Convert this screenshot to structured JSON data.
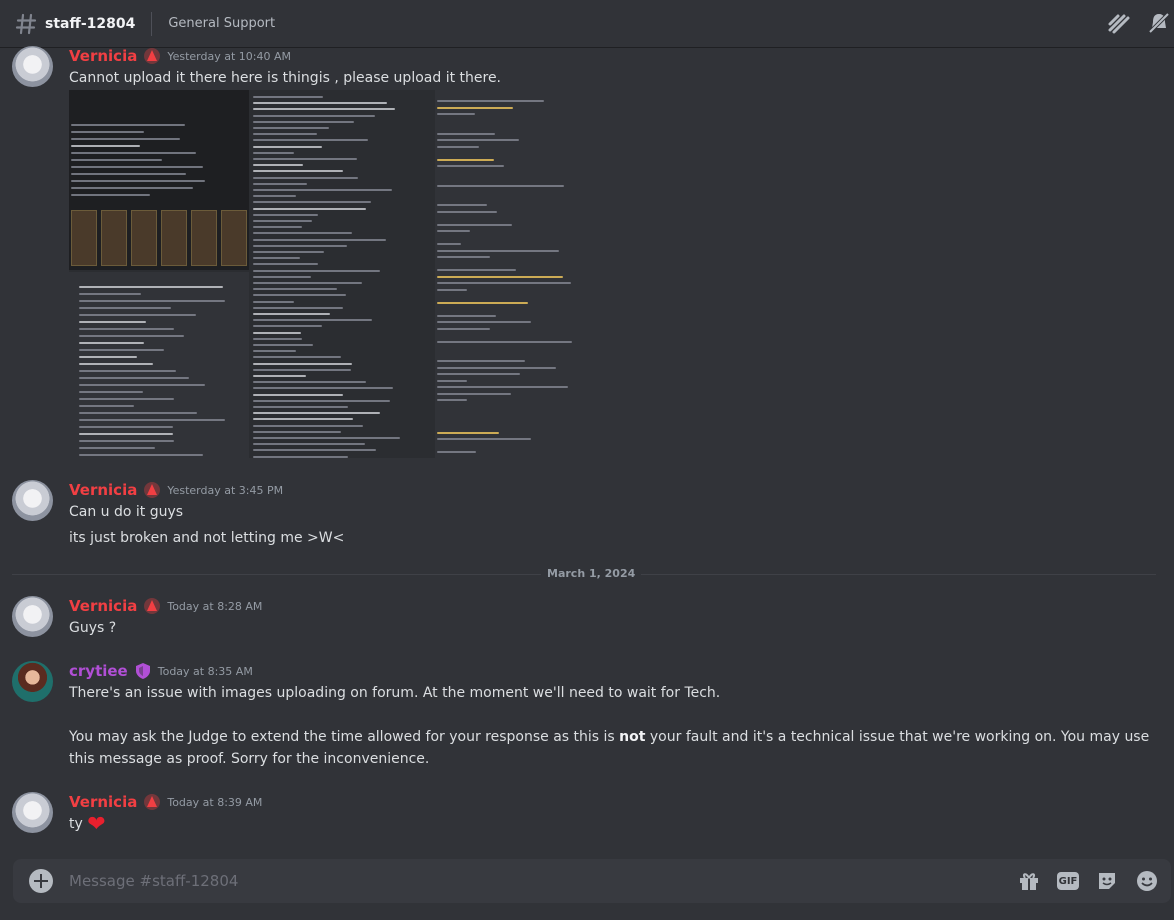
{
  "channel": {
    "name": "staff-12804",
    "topic": "General Support"
  },
  "messages": [
    {
      "author": "Vernicia",
      "timestamp": "Yesterday at 10:40 AM",
      "lines": [
        "Cannot upload it there here is thingis , please upload it there."
      ]
    },
    {
      "author": "Vernicia",
      "timestamp": "Yesterday at 3:45 PM",
      "lines": [
        "Can u do it guys",
        "its just broken and not letting me >W<"
      ]
    },
    {
      "author": "Vernicia",
      "timestamp": "Today at 8:28 AM",
      "lines": [
        "Guys ?"
      ]
    },
    {
      "author": "crytiee",
      "timestamp": "Today at 8:35 AM",
      "lines": [
        "There's an issue with images uploading on forum. At the moment we'll need to wait for Tech."
      ],
      "para2_before": "You may ask the Judge to extend the time allowed for your response as this is ",
      "para2_bold": "not",
      "para2_after": " your fault and it's a technical issue that we're working on. You may use",
      "para2_line2": "this message as proof. Sorry for the inconvenience."
    },
    {
      "author": "Vernicia",
      "timestamp": "Today at 8:39 AM",
      "lines": [
        "ty"
      ]
    }
  ],
  "date_divider": "March 1, 2024",
  "composer": {
    "placeholder": "Message #staff-12804",
    "gif_label": "GIF"
  },
  "colors": {
    "background": "#313338",
    "vernicia_name": "#f23f43",
    "crytiee_name": "#b14fd6"
  }
}
